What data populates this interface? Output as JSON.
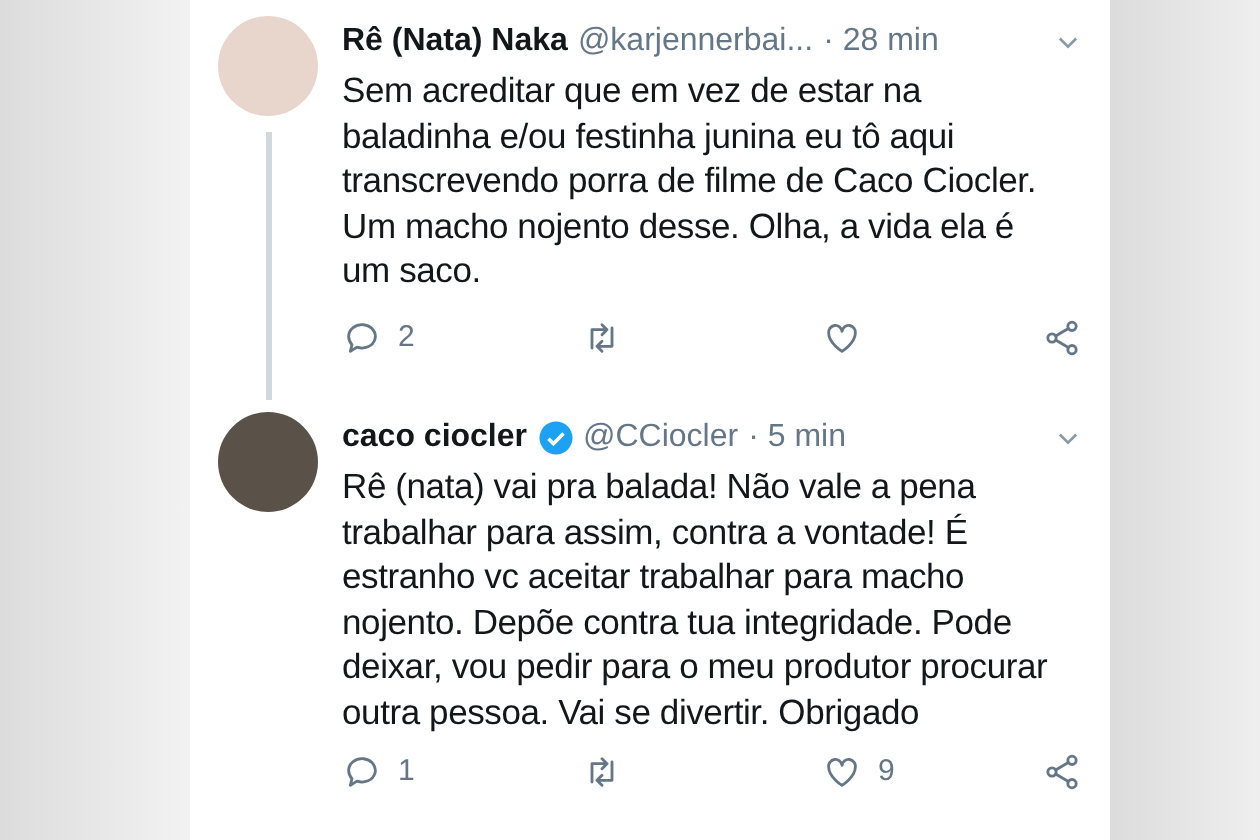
{
  "tweets": [
    {
      "name": "Rê (Nata) Naka",
      "verified": false,
      "handle": "@karjennerbai...",
      "time": "· 28 min",
      "text": "Sem acreditar que em vez de estar na baladinha e/ou festinha junina eu tô aqui transcrevendo porra de filme de Caco Ciocler. Um macho nojento desse. Olha, a vida ela é um saco.",
      "replies": "2",
      "thread": true
    },
    {
      "name": "caco ciocler",
      "verified": true,
      "handle": "@CCiocler",
      "time": "· 5 min",
      "text": "Rê (nata) vai pra balada! Não vale a pena trabalhar para assim, contra a vontade! É estranho vc aceitar trabalhar para macho nojento. Depõe contra tua integridade. Pode deixar, vou pedir para o meu produtor procurar outra pessoa. Vai se divertir. Obrigado",
      "replies": "1",
      "likes": "9",
      "thread": false
    }
  ]
}
